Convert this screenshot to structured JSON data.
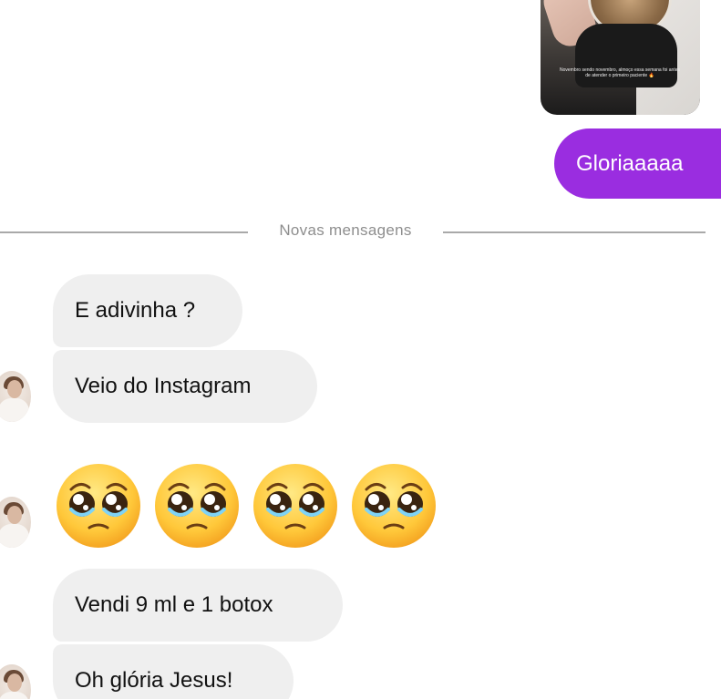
{
  "conversation": {
    "sent_story": {
      "caption": "Novembro sendo novembro, almoço essa semana foi antes de atender o primeiro paciente 🔥"
    },
    "sent_message": "Gloriaaaaa",
    "divider_label": "Novas mensagens",
    "received": [
      {
        "text": "E adivinha ?"
      },
      {
        "text": "Veio do Instagram"
      },
      {
        "emoji": [
          "pleading-face",
          "pleading-face",
          "pleading-face",
          "pleading-face"
        ]
      },
      {
        "text": "Vendi 9 ml e 1 botox"
      },
      {
        "text": "Oh glória Jesus!"
      }
    ]
  },
  "colors": {
    "sent_bubble": "#9a2de0",
    "received_bubble": "#efefef",
    "divider": "#a9a9a9",
    "divider_text": "#8e8e8e"
  },
  "icons": {
    "emoji": "pleading-face-emoji",
    "avatar": "contact-avatar"
  }
}
